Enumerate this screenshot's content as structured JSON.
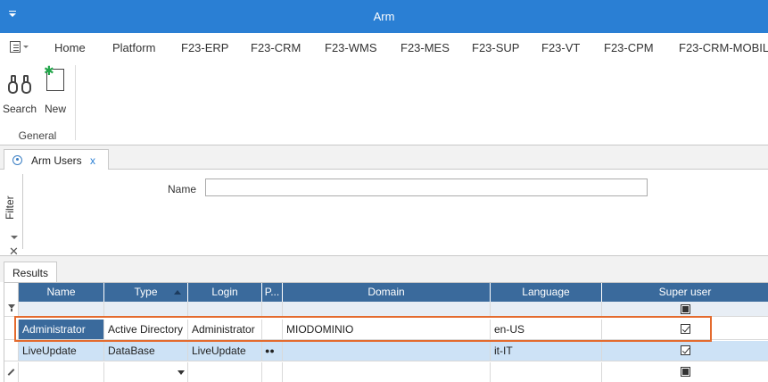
{
  "titlebar": {
    "title": "Arm"
  },
  "menu": {
    "tabs": [
      "Home",
      "Platform",
      "F23-ERP",
      "F23-CRM",
      "F23-WMS",
      "F23-MES",
      "F23-SUP",
      "F23-VT",
      "F23-CPM",
      "F23-CRM-MOBILE"
    ]
  },
  "ribbon": {
    "search_label": "Search",
    "new_label": "New",
    "group_label": "General",
    "new_icon_color": "#22a64a"
  },
  "doc_tab": {
    "label": "Arm Users",
    "close": "x"
  },
  "filter": {
    "side_label": "Filter",
    "name_label": "Name",
    "name_value": "",
    "close_glyph": "✕"
  },
  "results_tab": {
    "label": "Results"
  },
  "grid": {
    "columns": [
      "Name",
      "Type",
      "Login",
      "P...",
      "Domain",
      "Language",
      "Super user"
    ],
    "sorted_column": "Type",
    "rows": [
      {
        "name": "Administrator",
        "type": "Active Directory",
        "login": "Administrator",
        "password": "",
        "domain": "MIODOMINIO",
        "language": "en-US",
        "super_user": true
      },
      {
        "name": "LiveUpdate",
        "type": "DataBase",
        "login": "LiveUpdate",
        "password": "●●",
        "domain": "",
        "language": "it-IT",
        "super_user": true
      }
    ],
    "header_color": "#3a6a9c",
    "selected_row_color": "#cde2f6",
    "highlight_color": "#e46b2e"
  }
}
